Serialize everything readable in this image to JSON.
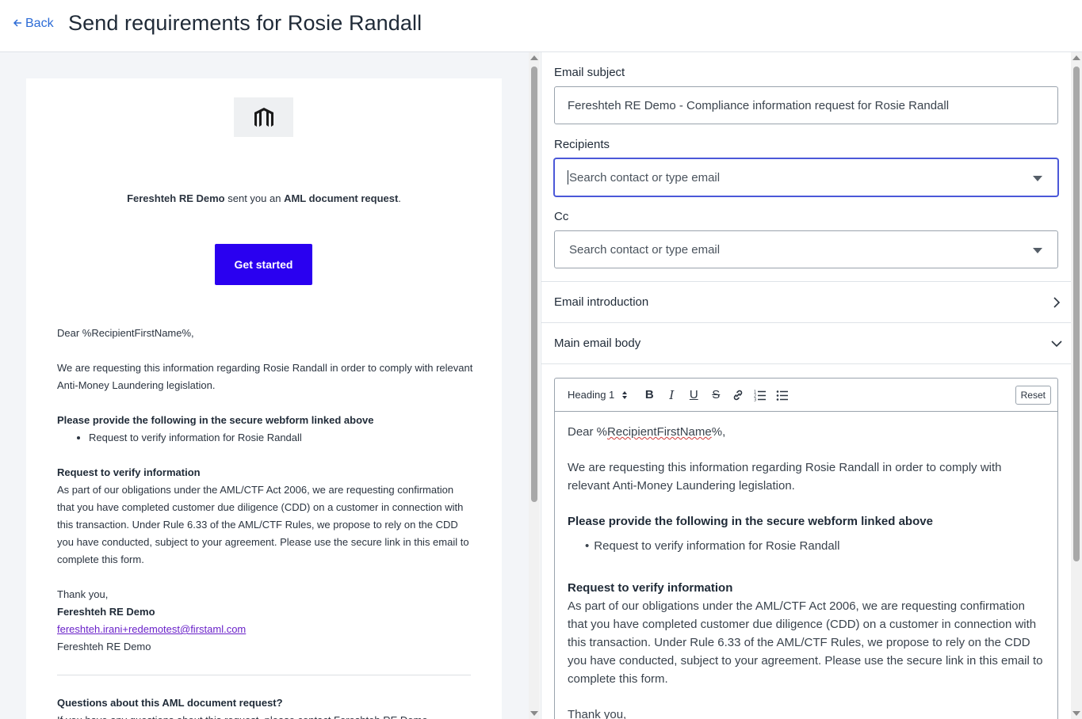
{
  "header": {
    "back_label": "Back",
    "title": "Send requirements for Rosie Randall"
  },
  "preview": {
    "sender_name": "Fereshteh RE Demo",
    "sent_text": " sent you an ",
    "request_type": "AML document request",
    "sent_suffix": ".",
    "cta_label": "Get started",
    "greeting": "Dear %RecipientFirstName%,",
    "intro": "We are requesting this information regarding Rosie Randall in order to comply with relevant Anti-Money Laundering legislation.",
    "provide_heading": "Please provide the following in the secure webform linked above",
    "items": [
      "Request to verify information for Rosie Randall"
    ],
    "verify_heading": "Request to verify information",
    "verify_body": "As part of our obligations under the AML/CTF Act 2006, we are requesting confirmation that you have completed customer due diligence (CDD) on a customer in connection with this transaction. Under Rule 6.33 of the AML/CTF Rules, we propose to rely on the CDD you have conducted, subject to your agreement. Please use the secure link in this email to complete this form.",
    "thanks": "Thank you,",
    "signature_name": "Fereshteh RE Demo",
    "signature_email": "fereshteh.irani+redemotest@firstaml.com",
    "signature_company": "Fereshteh RE Demo",
    "questions_heading": "Questions about this AML document request?",
    "questions_sub": "If you have any questions about this request, please contact Fereshteh RE Demo"
  },
  "form": {
    "subject_label": "Email subject",
    "subject_value": "Fereshteh RE Demo - Compliance information request for Rosie Randall",
    "recipients_label": "Recipients",
    "recipients_placeholder": "Search contact or type email",
    "cc_label": "Cc",
    "cc_placeholder": "Search contact or type email",
    "intro_section": "Email introduction",
    "body_section": "Main email body"
  },
  "editor": {
    "heading_select": "Heading 1",
    "reset_label": "Reset",
    "greeting_prefix": "Dear %",
    "greeting_var": "RecipientFirstName",
    "greeting_suffix": "%,",
    "intro": "We are requesting this information regarding Rosie Randall in order to comply with relevant Anti-Money Laundering legislation.",
    "provide_heading": "Please provide the following in the secure webform linked above",
    "items": [
      "Request to verify information for Rosie Randall"
    ],
    "verify_heading": "Request to verify information",
    "verify_body": "As part of our obligations under the AML/CTF Act 2006, we are requesting confirmation that you have completed customer due diligence (CDD) on a customer in connection with this transaction. Under Rule 6.33 of the AML/CTF Rules, we propose to rely on the CDD you have conducted, subject to your agreement. Please use the secure link in this email to complete this form.",
    "thanks": "Thank you,"
  },
  "colors": {
    "accent": "#2a00f0",
    "link": "#2c6bd6",
    "focus": "#4b58d8",
    "email_link": "#6a22c9"
  },
  "icons": {
    "back": "arrow-left-icon",
    "logo": "firm-logo",
    "dropdown": "triangle-down-icon",
    "collapsed": "chevron-right-icon",
    "expanded": "chevron-down-icon"
  }
}
